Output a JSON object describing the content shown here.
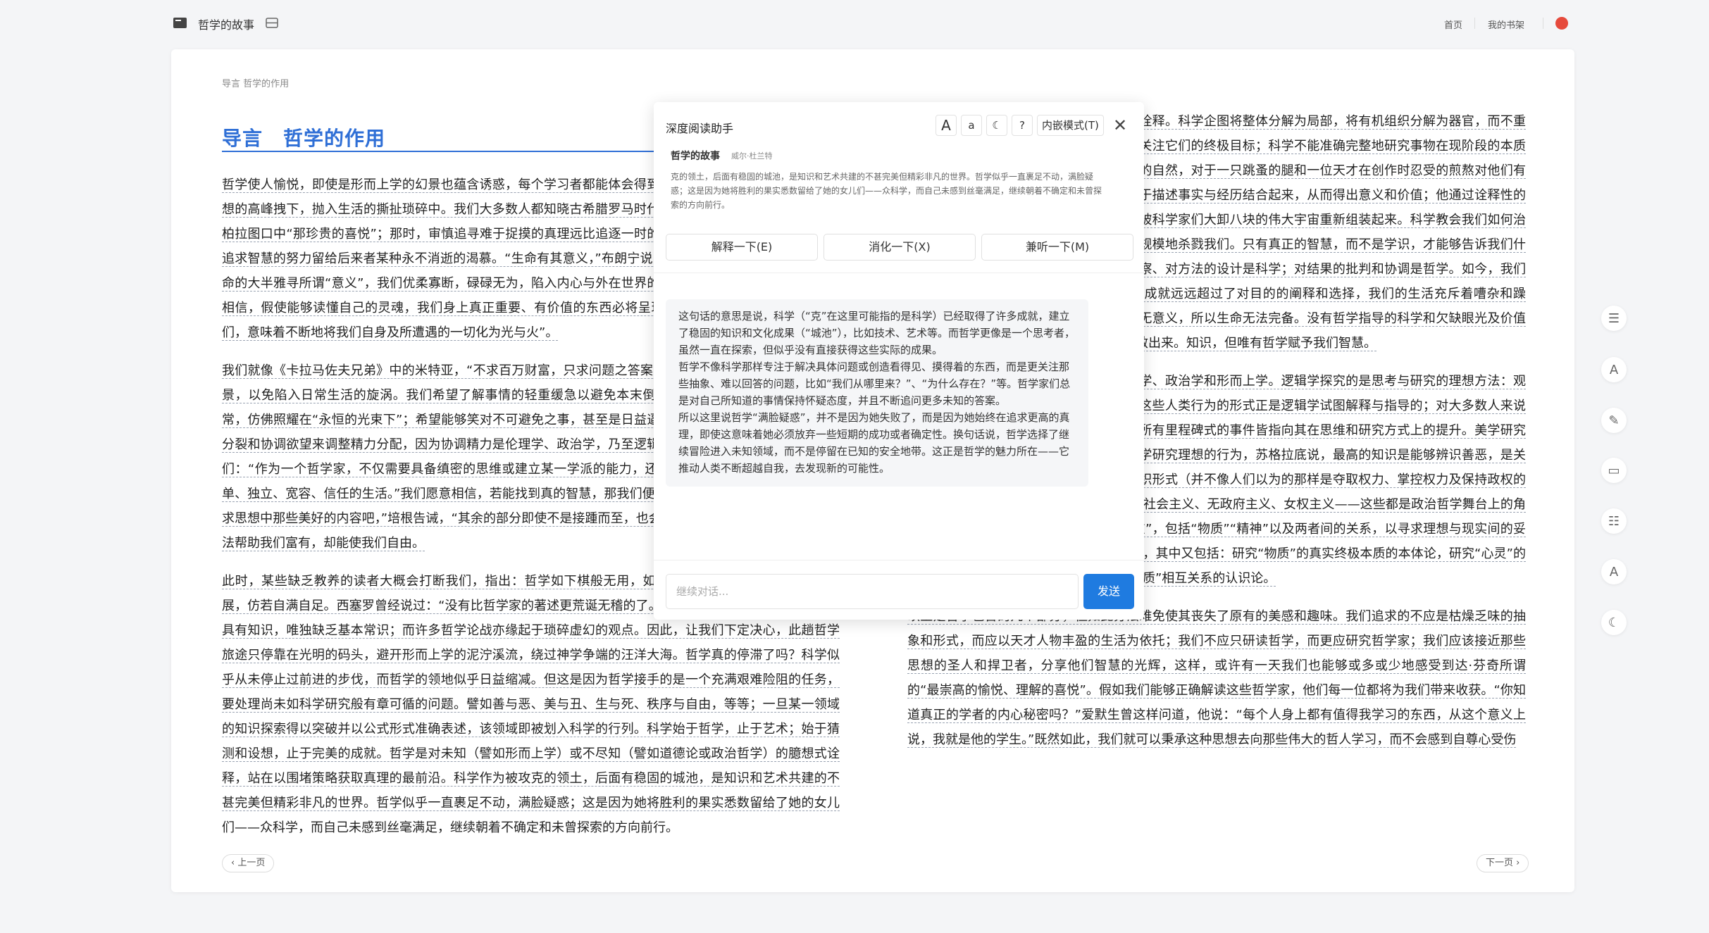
{
  "topbar": {
    "book_title": "哲学的故事",
    "nav_home": "首页",
    "nav_shelf": "我的书架"
  },
  "breadcrumb": "导言 哲学的作用",
  "chapter_title": "导言　哲学的作用",
  "left_paragraphs": [
    "哲学使人愉悦，即使是形而上学的幻景也蕴含诱惑，每个学习者都能体会得到，直到生活的物质需要将他从思想的高峰拽下，抛入生活的撕扯琐碎中。我们大多数人都知晓古希腊罗马时代的高度，那时的哲学确实称得上柏拉图口中“那珍贵的喜悦”；那时，审慎追寻难于捉摸的真理远比追逐一时的欢愉更可贵得多。人类社会早期追求智慧的努力留给后来者某种永不消逝的渴慕。“生命有其意义，”布朗宁说，“我们的探求是我精神所寄。”生命的大半雅寻所谓“意义”，我们优柔寡断，碌碌无为，陷入内心与外在世界的混乱无序作斗争；但是我们愿意相信，假使能够读懂自己的灵魂，我们身上真正重要、有价值的东西必将呈现。我们想要弄清楚“生命之于我们，意味着不断地将我们自身及所遭遇的一切化为光与火”。",
    "我们就像《卡拉马佐夫兄弟》中的米特亚，“不求百万财富，只求问题之答案”；我们想要把握事物的价值和前景，以免陷入日常生活的旋涡。我们希望了解事情的轻重缓急以避免本末倒置；我们想从永恒的视角看待无常，仿佛照耀在“永恒的光束下”；希望能够笑对不可避免之事，甚至是日益逼近的死亡。我们想要学会统合万分裂和协调欲望来调整精力分配，因为协调精力是伦理学、政治学，乃至逻辑学最终的追求。斯宾诺莎告诉我们：“作为一个哲学家，不仅需要具备缜密的思维或建立某一学派的能力，还需要热爱智慧，并按智慧过上简单、独立、宽容、信任的生活。”我们愿意相信，若能找到真的智慧，那我们便拥有一切。培根告诫我们“应当寻求思想中那些美好的内容吧，”培根告诫，“其余的部分即使不是接踵而至，也会不再那么令人神伤。”真理或许无法帮助我们富有，却能使我们自由。",
    "此时，某些缺乏教养的读者大概会打断我们，指出：哲学如下棋般无用，如最后的答案一样是空谈，无所进展，仿若自满自足。西塞罗曾经说过：“没有比哲学家的著述更荒诞无稽的了。”的确，有些哲学家拥有智慧而非具有知识，唯独缺乏基本常识；而许多哲学论战亦缘起于琐碎虚幻的观点。因此，让我们下定决心，此趟哲学旅途只停靠在光明的码头，避开形而上学的泥泞溪流，绕过神学争端的汪洋大海。哲学真的停滞了吗？科学似乎从未停止过前进的步伐，而哲学的领地似乎日益缩减。但这是因为哲学接手的是一个充满艰难险阻的任务，要处理尚未如科学研究般有章可循的问题。譬如善与恶、美与丑、生与死、秩序与自由，等等；一旦某一领域的知识探索得以突破并以公式形式准确表述，该领域即被划入科学的行列。科学始于哲学，止于艺术；始于猜测和设想，止于完美的成就。哲学是对未知（譬如形而上学）或不尽知（譬如道德论或政治哲学）的臆想式诠释，站在以围堵策略获取真理的最前沿。科学作为被攻克的领土，后面有稳固的城池，是知识和艺术共建的不甚完美但精彩非凡的世界。哲学似乎一直裹足不动，满脸疑惑；这是因为她将胜利的果实悉数留给了她的女儿们——众科学，而自己未感到丝毫满足，继续朝着不确定和未曾探索的方向前行。"
  ],
  "right_paragraphs": [
    "如果科学只是分析式描述，哲学是综合式诠释。科学企图将整体分解为局部，将有机组织分解为器官，而不重视事物的价值或者可能的理想形态，也不关注它们的终极目标；科学不能准确完整地研究事物在现阶段的本质和变化是其全部意义。如同屠格涅夫诗中的自然，对于一只跳蚤的腿和一位天才在创作时忍受的煎熬对他们有着同等的研究价值。然而，哲学家不满足于描述事实与经历结合起来，从而得出意义和价值；他通过诠释性的综合建立事物间的联系。哲学家，尝试把被科学家们大卸八块的伟大宇宙重新组装起来。科学教会我们如何治愈疾病和降低着死亡率，一面又用战争大规模地杀戮我们。只有真正的智慧，而不是学识，才能够告诉我们什么时候该救，什么时候该杀。对过程的观察、对方法的设计是科学；对结果的批判和协调是哲学。如今，我们在生存手段和生存工具的发展方面取得的成就远远超过了对目的的阐释和选择，我们的生活充斥着嘈杂和躁动，空洞无聊。因为不指向欲求的事实毫无意义，所以生命无法完备。没有哲学指导的科学和欠缺眼光及价值的事实无法将我们从大灾难与绝望之中拯救出来。知识，但唯有哲学赋予我们智慧。",
    "具体而言，哲学包括逻辑学、美学、伦理学、政治学和形而上学。逻辑学探究的是思考与研究的理想方法：观察和内省、假设和实验、分析和综合——这些人类行为的形式正是逻辑学试图解释与指导的；对大多数人来说这是一门无聊的学科，然而人类思想史上所有里程碑式的事件皆指向其在思维和研究方式上的提升。美学研究理想的形式，即美，是艺术的哲学。伦理学研究理想的行为，苏格拉底说，最高的知识是能够辨识善恶，是关于生活的智慧。政治学研究理想的社会组织形式（并不像人们以为的那样是夺取权力、掌控权力及保持政权的艺术和科学）；君主制、贵族制、民主制、社会主义、无政府主义、女权主义——这些都是政治哲学舞台上的角色。最后，形而上学研究万物的“终极实在”，包括“物质”“精神”以及两者间的关系，以寻求理想与现实间的妥协与平衡，这也使得它更难为世人所接受），其中又包括：研究“物质”的真实终极本质的本体论，研究“心灵”的哲学心理学，研究认知过程中“心灵”与“物质”相互关系的认识论。",
    "以上是哲学包含的几个部分，但如此分法难免使其丧失了原有的美感和趣味。我们追求的不应是枯燥乏味的抽象和形式，而应以天才人物丰盈的生活为依托；我们不应只研读哲学，而更应研究哲学家；我们应该接近那些思想的圣人和捍卫者，分享他们智慧的光辉，这样，或许有一天我们也能够或多或少地感受到达·芬奇所谓的“最崇高的愉悦、理解的喜悦”。假如我们能够正确解读这些哲学家，他们每一位都将为我们带来收获。“你知道真正的学者的内心秘密吗？”爱默生曾这样问道，他说：“每个人身上都有值得我学习的东西，从这个意义上说，我就是他的学生。”既然如此，我们就可以秉承这种思想去向那些伟大的哲人学习，而不会感到自尊心受伤"
  ],
  "pager": {
    "prev": "上一页",
    "next": "下一页"
  },
  "assistant": {
    "title": "深度阅读助手",
    "tool_large_a": "A",
    "tool_small_a": "a",
    "tool_mode": "内嵌模式(T)",
    "book": "哲学的故事",
    "author": "威尔·杜兰特",
    "quote": "克的领土，后面有稳固的城池，是知识和艺术共建的不甚完美但精彩非凡的世界。哲学似乎一直裹足不动，满脸疑惑；这是因为她将胜利的果实悉数留给了她的女儿们——众科学，而自己未感到丝毫满足，继续朝着不确定和未曾探索的方向前行。",
    "actions": [
      "解释一下(E)",
      "消化一下(X)",
      "兼听一下(M)"
    ],
    "answer": [
      "这句话的意思是说，科学（“克”在这里可能指的是科学）已经取得了许多成就，建立了稳固的知识和文化成果（“城池”），比如技术、艺术等。而哲学更像是一个思考者，虽然一直在探索，但似乎没有直接获得这些实际的成果。",
      "哲学不像科学那样专注于解决具体问题或创造看得见、摸得着的东西，而是更关注那些抽象、难以回答的问题，比如“我们从哪里来？”、“为什么存在？”等。哲学家们总是对自己所知道的事情保持怀疑态度，并且不断追问更多未知的答案。",
      "所以这里说哲学“满脸疑惑”，并不是因为她失败了，而是因为她始终在追求更高的真理，即使这意味着她必须放弃一些短期的成功或者确定性。换句话说，哲学选择了继续冒险进入未知领域，而不是停留在已知的安全地带。这正是哲学的魅力所在——它推动人类不断超越自我，去发现新的可能性。"
    ],
    "input_placeholder": "继续对话...",
    "send": "发送"
  },
  "colors": {
    "accent": "#2f6fd6",
    "send": "#1f7be0",
    "avatar": "#e64a3c"
  }
}
